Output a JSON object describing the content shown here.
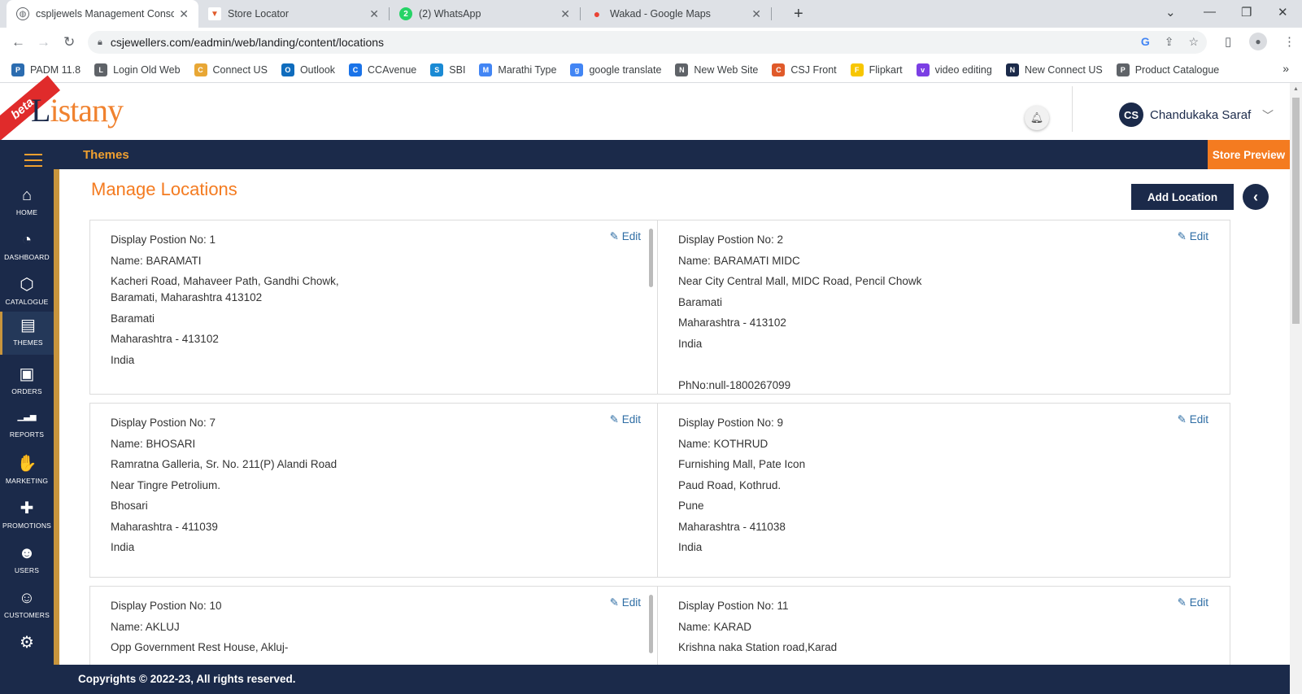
{
  "browser": {
    "tabs": [
      {
        "title": "cspljewels Management Console",
        "icon": "globe-icon",
        "active": true
      },
      {
        "title": "Store Locator",
        "icon": "store-icon",
        "active": false
      },
      {
        "title": "(2) WhatsApp",
        "icon": "whatsapp-icon",
        "active": false
      },
      {
        "title": "Wakad - Google Maps",
        "icon": "maps-pin-icon",
        "active": false
      }
    ],
    "url": "csjewellers.com/eadmin/web/landing/content/locations",
    "bookmarks": [
      {
        "label": "PADM 11.8",
        "icon": "padm-icon",
        "color": "#2b6cb0"
      },
      {
        "label": "Login Old Web",
        "icon": "globe-icon",
        "color": "#5f6368"
      },
      {
        "label": "Connect US",
        "icon": "connect-icon",
        "color": "#e8a735"
      },
      {
        "label": "Outlook",
        "icon": "outlook-icon",
        "color": "#0f6cbd"
      },
      {
        "label": "CCAvenue",
        "icon": "ccavenue-icon",
        "color": "#1a73e8"
      },
      {
        "label": "SBI",
        "icon": "sbi-icon",
        "color": "#1a8ad4"
      },
      {
        "label": "Marathi Type",
        "icon": "google-icon",
        "color": "#4285f4"
      },
      {
        "label": "google translate",
        "icon": "google-icon",
        "color": "#4285f4"
      },
      {
        "label": "New Web Site",
        "icon": "globe-icon",
        "color": "#5f6368"
      },
      {
        "label": "CSJ Front",
        "icon": "csj-icon",
        "color": "#e05a2a"
      },
      {
        "label": "Flipkart",
        "icon": "flipkart-icon",
        "color": "#f7c600"
      },
      {
        "label": "video editing",
        "icon": "video-icon",
        "color": "#7b3fe4"
      },
      {
        "label": "New Connect US",
        "icon": "react-icon",
        "color": "#1b2a4a"
      },
      {
        "label": "Product Catalogue",
        "icon": "globe-icon",
        "color": "#5f6368"
      }
    ]
  },
  "header": {
    "beta": "beta",
    "logo_first": "L",
    "logo_mid": "i",
    "logo_second": "stany",
    "user_initials": "CS",
    "user_name": "Chandukaka Saraf"
  },
  "topnav": {
    "title": "Themes",
    "store_preview": "Store Preview"
  },
  "sidebar": [
    {
      "label": "HOME",
      "icon": "home-icon",
      "glyph": "⌂"
    },
    {
      "label": "DASHBOARD",
      "icon": "dashboard-icon",
      "glyph": "◔"
    },
    {
      "label": "CATALOGUE",
      "icon": "catalogue-icon",
      "glyph": "⬡"
    },
    {
      "label": "THEMES",
      "icon": "themes-icon",
      "glyph": "▤",
      "active": true
    },
    {
      "label": "ORDERS",
      "icon": "orders-icon",
      "glyph": "▣"
    },
    {
      "label": "REPORTS",
      "icon": "reports-icon",
      "glyph": "▁▃▅"
    },
    {
      "label": "MARKETING",
      "icon": "handshake-icon",
      "glyph": "✋"
    },
    {
      "label": "PROMOTIONS",
      "icon": "promotions-icon",
      "glyph": "✚"
    },
    {
      "label": "USERS",
      "icon": "users-icon",
      "glyph": "☻"
    },
    {
      "label": "CUSTOMERS",
      "icon": "customers-icon",
      "glyph": "☺"
    },
    {
      "label": "",
      "icon": "settings-gear-icon",
      "glyph": "⚙"
    }
  ],
  "main": {
    "title": "Manage Locations",
    "add_button": "Add Location",
    "edit_label": "Edit",
    "locations": [
      {
        "lines": [
          "Display Postion No: 1",
          "Name: BARAMATI",
          "Kacheri Road, Mahaveer Path, Gandhi Chowk,\nBaramati, Maharashtra 413102",
          "Baramati",
          "Maharashtra - 413102",
          "India"
        ],
        "scroll": true
      },
      {
        "lines": [
          "Display Postion No: 2",
          "Name: BARAMATI MIDC",
          "Near City Central Mall, MIDC Road, Pencil Chowk",
          "Baramati",
          "Maharashtra - 413102",
          "India",
          "",
          "PhNo:null-1800267099"
        ],
        "scroll": false
      },
      {
        "lines": [
          "Display Postion No: 7",
          "Name: BHOSARI",
          "Ramratna Galleria, Sr. No. 211(P) Alandi Road",
          "Near Tingre Petrolium.",
          "Bhosari",
          "Maharashtra - 411039",
          "India"
        ],
        "scroll": false
      },
      {
        "lines": [
          "Display Postion No: 9",
          "Name: KOTHRUD",
          "Furnishing Mall, Pate Icon",
          "Paud Road, Kothrud.",
          "Pune",
          "Maharashtra - 411038",
          "India"
        ],
        "scroll": false
      },
      {
        "lines": [
          "Display Postion No: 10",
          "Name: AKLUJ",
          "Opp Government Rest House, Akluj-"
        ],
        "scroll": true
      },
      {
        "lines": [
          "Display Postion No: 11",
          "Name: KARAD",
          "Krishna naka Station road,Karad"
        ],
        "scroll": false
      }
    ]
  },
  "footer": {
    "text": "Copyrights © 2022-23, All rights reserved."
  }
}
